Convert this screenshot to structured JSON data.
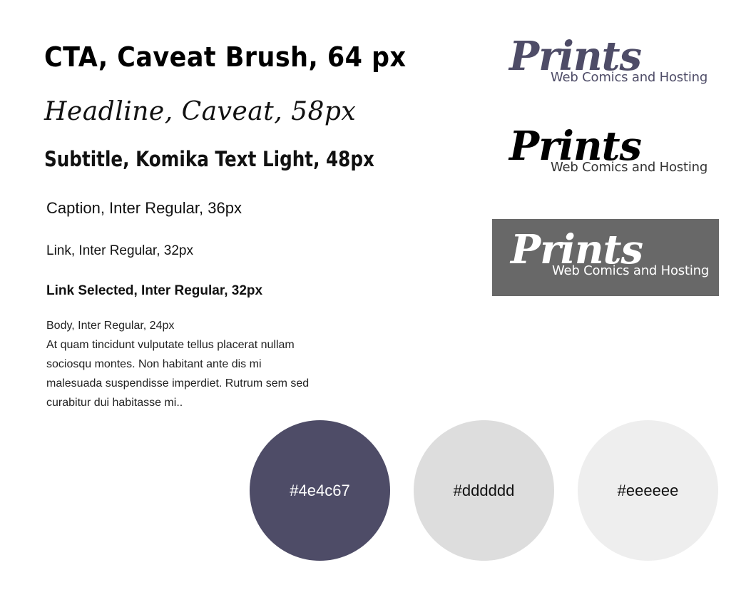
{
  "typography": {
    "cta": "CTA, Caveat Brush, 64 px",
    "headline": "Headline, Caveat, 58px",
    "subtitle": "Subtitle, Komika Text Light, 48px",
    "caption": "Caption, Inter Regular, 36px",
    "link": "Link, Inter Regular, 32px",
    "link_selected": "Link Selected, Inter Regular, 32px",
    "body_lines": [
      "Body, Inter Regular, 24px",
      "At quam tincidunt vulputate tellus placerat nullam",
      "sociosqu montes. Non habitant ante dis mi",
      "malesuada suspendisse imperdiet. Rutrum sem sed",
      "curabitur dui habitasse mi.."
    ]
  },
  "logos": [
    {
      "brand": "Prints",
      "tagline": "Web Comics and Hosting",
      "brand_color": "#4e4c67",
      "tagline_color": "#4e4c67",
      "background": "#ffffff"
    },
    {
      "brand": "Prints",
      "tagline": "Web Comics and Hosting",
      "brand_color": "#000000",
      "tagline_color": "#333333",
      "background": "#ffffff"
    },
    {
      "brand": "Prints",
      "tagline": "Web Comics and Hosting",
      "brand_color": "#ffffff",
      "tagline_color": "#ffffff",
      "background": "#686868"
    }
  ],
  "swatches": [
    {
      "label": "#4e4c67",
      "color": "#4e4c67",
      "text_color": "#ffffff"
    },
    {
      "label": "#dddddd",
      "color": "#dddddd",
      "text_color": "#111111"
    },
    {
      "label": "#eeeeee",
      "color": "#eeeeee",
      "text_color": "#111111"
    }
  ]
}
